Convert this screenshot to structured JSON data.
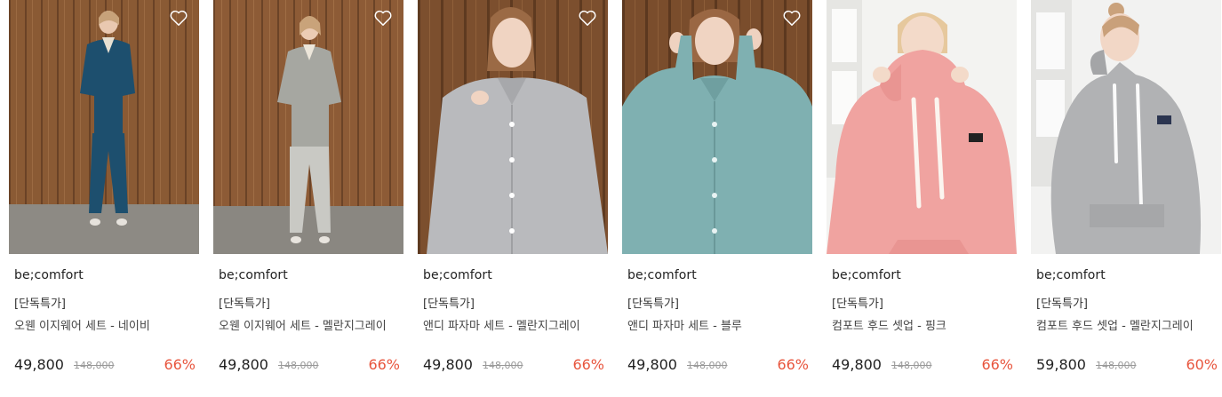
{
  "colors": {
    "discount": "#e8553d",
    "heart": "#ffffff"
  },
  "products": [
    {
      "brand": "be;comfort",
      "tag": "[단독특가]",
      "name": "오웬 이지웨어 세트 - 네이비",
      "price": "49,800",
      "original_price": "148,000",
      "discount": "66%",
      "icon": "heart-outline-icon",
      "image": "model in navy easywear set, wood panel background"
    },
    {
      "brand": "be;comfort",
      "tag": "[단독특가]",
      "name": "오웬 이지웨어 세트 - 멜란지그레이",
      "price": "49,800",
      "original_price": "148,000",
      "discount": "66%",
      "icon": "heart-outline-icon",
      "image": "model in grey easywear set, wood panel background"
    },
    {
      "brand": "be;comfort",
      "tag": "[단독특가]",
      "name": "앤디 파자마 세트 - 멜란지그레이",
      "price": "49,800",
      "original_price": "148,000",
      "discount": "66%",
      "icon": "heart-outline-icon",
      "image": "model in grey pajama shirt, wood panel background"
    },
    {
      "brand": "be;comfort",
      "tag": "[단독특가]",
      "name": "앤디 파자마 세트 - 블루",
      "price": "49,800",
      "original_price": "148,000",
      "discount": "66%",
      "icon": "heart-outline-icon",
      "image": "model in blue pajama shirt, wood panel background"
    },
    {
      "brand": "be;comfort",
      "tag": "[단독특가]",
      "name": "컴포트 후드 셋업 - 핑크",
      "price": "49,800",
      "original_price": "148,000",
      "discount": "66%",
      "image": "model in pink hoodie, light background"
    },
    {
      "brand": "be;comfort",
      "tag": "[단독특가]",
      "name": "컴포트 후드 셋업 - 멜란지그레이",
      "price": "59,800",
      "original_price": "148,000",
      "discount": "60%",
      "image": "model in grey hoodie, light background"
    }
  ]
}
